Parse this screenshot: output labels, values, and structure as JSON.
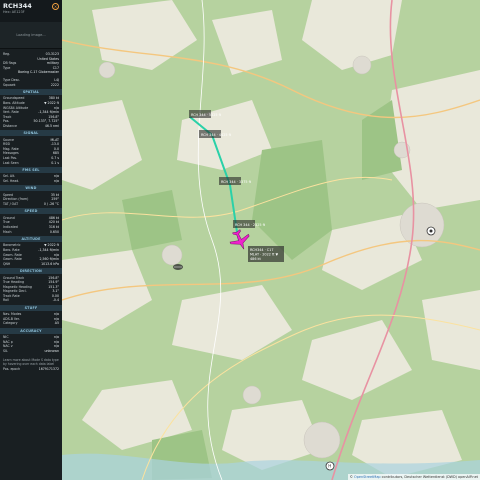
{
  "aircraft": {
    "callsign": "RCH344",
    "reg_line": "Hex:  AE123F",
    "photo_text": "Loading image..."
  },
  "info_rows": [
    [
      "Reg.",
      "03-3123"
    ],
    [
      "",
      "United States"
    ],
    [
      "DB flags",
      "military"
    ],
    [
      "Type",
      "C17"
    ],
    [
      "",
      "Boeing C-17 Globemaster"
    ]
  ],
  "type_rows": [
    [
      "Type Desc.",
      "L4J"
    ],
    [
      "Squawk",
      "2222"
    ]
  ],
  "sections": {
    "spatial": {
      "title": "SPATIAL",
      "rows": [
        [
          "Groundspeed",
          "380 kt"
        ],
        [
          "Baro. Altitude",
          "▼ 2022 ft"
        ],
        [
          "WGS84 Altitude",
          "n/a"
        ],
        [
          "Vert. Rate",
          "-1,344 ft/min"
        ],
        [
          "Track",
          "156.8°"
        ],
        [
          "Pos.",
          "50.133°, 7.725°"
        ],
        [
          "Distance",
          "46.5 nmi"
        ]
      ]
    },
    "signal": {
      "title": "SIGNAL",
      "rows": [
        [
          "Source",
          "MLAT"
        ],
        [
          "RSSI",
          "-13.0"
        ],
        [
          "Msg. Rate",
          "0.0"
        ],
        [
          "Messages",
          "685"
        ],
        [
          "Last Pos.",
          "0.7 s"
        ],
        [
          "Last Seen",
          "0.1 s"
        ]
      ]
    },
    "fms": {
      "title": "FMS SEL",
      "rows": [
        [
          "Sel. Alt.",
          "n/a"
        ],
        [
          "Sel. Head.",
          "n/a"
        ]
      ]
    },
    "wind": {
      "title": "WIND",
      "rows": [
        [
          "Speed",
          "35 kt"
        ],
        [
          "Direction (from)",
          "259°"
        ],
        [
          "TAT / OAT",
          "0 / -26 °C"
        ]
      ]
    },
    "speed": {
      "title": "SPEED",
      "rows": [
        [
          "Ground",
          "486 kt"
        ],
        [
          "True",
          "420 kt"
        ],
        [
          "Indicated",
          "316 kt"
        ],
        [
          "Mach",
          "0.650"
        ]
      ]
    },
    "altitude": {
      "title": "ALTITUDE",
      "rows": [
        [
          "Barometric",
          "▼ 2022 ft"
        ],
        [
          "Baro. Rate",
          "-1,344 ft/min"
        ],
        [
          "Geom. Rate",
          "n/a"
        ],
        [
          "Geom. Rate",
          "2,560 ft/min"
        ],
        [
          "QNH",
          "1013.6 hPa"
        ]
      ]
    },
    "direction": {
      "title": "DIRECTION",
      "rows": [
        [
          "Ground Track",
          "156.8°"
        ],
        [
          "True Heading",
          "154.9°"
        ],
        [
          "Magnetic Heading",
          "151.3°"
        ],
        [
          "Magnetic Decl.",
          "3.1°"
        ],
        [
          "Track Rate",
          "0.00"
        ],
        [
          "Roll",
          "-0.4"
        ]
      ]
    },
    "stuff": {
      "title": "STUFF",
      "rows": [
        [
          "Nav. Modes",
          "n/a"
        ],
        [
          "ADS-B Ver.",
          "n/a"
        ],
        [
          "Category",
          "A5"
        ]
      ]
    },
    "accuracy": {
      "title": "ACCURACY",
      "rows": [
        [
          "NIC",
          "n/a"
        ],
        [
          "NAC p",
          "n/a"
        ],
        [
          "NAC v",
          "n/a"
        ],
        [
          "SIL",
          "unknown"
        ]
      ]
    }
  },
  "footer": {
    "note": "Learn more about Mode S data type by hovering over each data label",
    "pos_epoch_label": "Pos. epoch",
    "pos_epoch_value": "1679171372"
  },
  "map": {
    "trail_labels": [
      {
        "id": "t1",
        "text": "RCH 344 · 5325 ft"
      },
      {
        "id": "t2",
        "text": "RCH 344 · 4425 ft"
      },
      {
        "id": "t3",
        "text": "RCH 344 · 3375 ft"
      },
      {
        "id": "t4",
        "text": "RCH 344 · 2325 ft"
      }
    ],
    "aircraft_label_line1": "RCH344 · C17",
    "aircraft_label_line2": "MLAT · 2022 ft ▼",
    "aircraft_label_line3": "486 kt",
    "attribution_prefix": "© ",
    "attribution_osm": "OpenStreetMap",
    "attribution_rest": " contributors, Deutscher Wetterdienst (DWD) openAIP.net",
    "colors": {
      "trail": "#2ad1a8",
      "aircraft": "#ee22cc",
      "forest": "#a9cb93",
      "land": "#e9e8dc",
      "water": "#aad3df"
    }
  }
}
